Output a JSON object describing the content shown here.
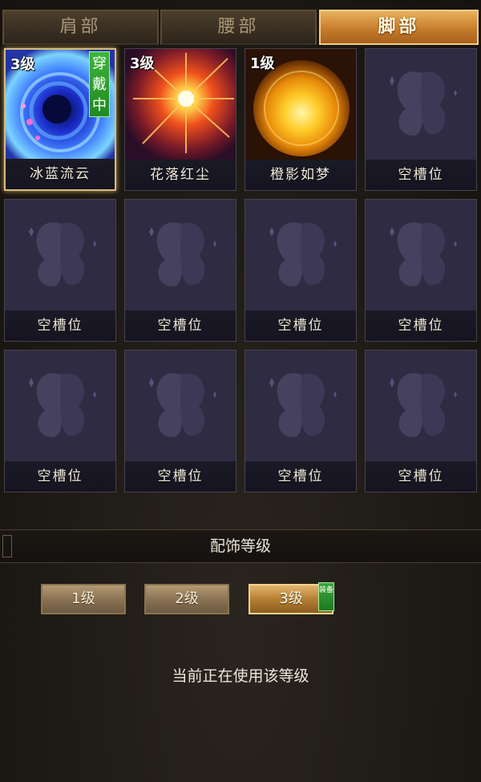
{
  "tabs": [
    {
      "label": "肩部",
      "active": false
    },
    {
      "label": "腰部",
      "active": false
    },
    {
      "label": "脚部",
      "active": true
    }
  ],
  "slots": [
    {
      "name": "冰蓝流云",
      "level": "3级",
      "badge": "穿戴中",
      "art": "blue-vortex-icon",
      "selected": true
    },
    {
      "name": "花落红尘",
      "level": "3级",
      "badge": "",
      "art": "red-burst-icon",
      "selected": false
    },
    {
      "name": "橙影如梦",
      "level": "1级",
      "badge": "",
      "art": "orange-sun-icon",
      "selected": false
    },
    {
      "name": "空槽位",
      "level": "",
      "badge": "",
      "art": "butterfly-icon",
      "selected": false
    },
    {
      "name": "空槽位",
      "level": "",
      "badge": "",
      "art": "butterfly-icon",
      "selected": false
    },
    {
      "name": "空槽位",
      "level": "",
      "badge": "",
      "art": "butterfly-icon",
      "selected": false
    },
    {
      "name": "空槽位",
      "level": "",
      "badge": "",
      "art": "butterfly-icon",
      "selected": false
    },
    {
      "name": "空槽位",
      "level": "",
      "badge": "",
      "art": "butterfly-icon",
      "selected": false
    },
    {
      "name": "空槽位",
      "level": "",
      "badge": "",
      "art": "butterfly-icon",
      "selected": false
    },
    {
      "name": "空槽位",
      "level": "",
      "badge": "",
      "art": "butterfly-icon",
      "selected": false
    },
    {
      "name": "空槽位",
      "level": "",
      "badge": "",
      "art": "butterfly-icon",
      "selected": false
    },
    {
      "name": "空槽位",
      "level": "",
      "badge": "",
      "art": "butterfly-icon",
      "selected": false
    }
  ],
  "section": {
    "title": "配饰等级"
  },
  "levels": [
    {
      "label": "1级",
      "active": false
    },
    {
      "label": "2级",
      "active": false
    },
    {
      "label": "3级",
      "active": true
    }
  ],
  "equip_badge": "装备",
  "status_text": "当前正在使用该等级"
}
